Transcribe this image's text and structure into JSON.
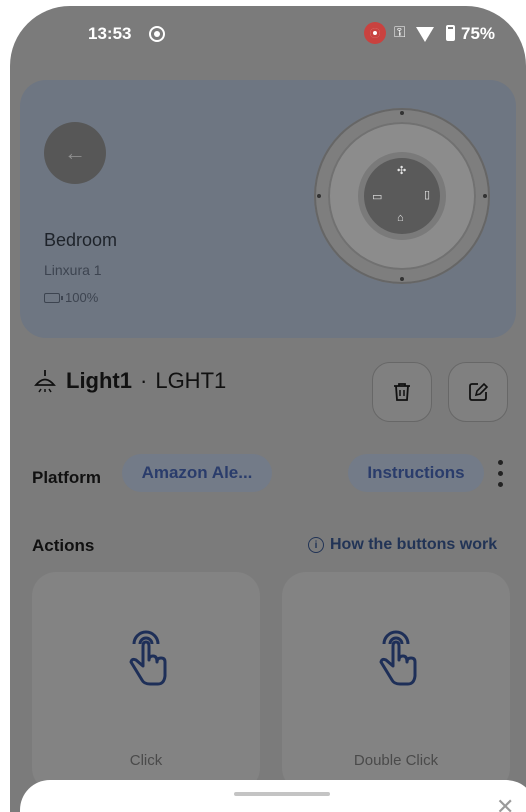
{
  "status_bar": {
    "time": "13:53",
    "battery_percent": "75%"
  },
  "device_header": {
    "room": "Bedroom",
    "model": "Linxura 1",
    "battery": "100%"
  },
  "title": {
    "name": "Light1",
    "separator": "·",
    "code": "LGHT1"
  },
  "platform": {
    "label": "Platform",
    "value": "Amazon Ale...",
    "instructions": "Instructions"
  },
  "actions": {
    "label": "Actions",
    "help": "How the buttons work",
    "cards": [
      {
        "label": "Click",
        "icon": "tap-hand-icon"
      },
      {
        "label": "Double Click",
        "icon": "tap-hand-icon"
      }
    ]
  },
  "colors": {
    "accent": "#2a3c6b",
    "scrim": "#7b7b7b",
    "icon_blue": "#1e2f58"
  }
}
